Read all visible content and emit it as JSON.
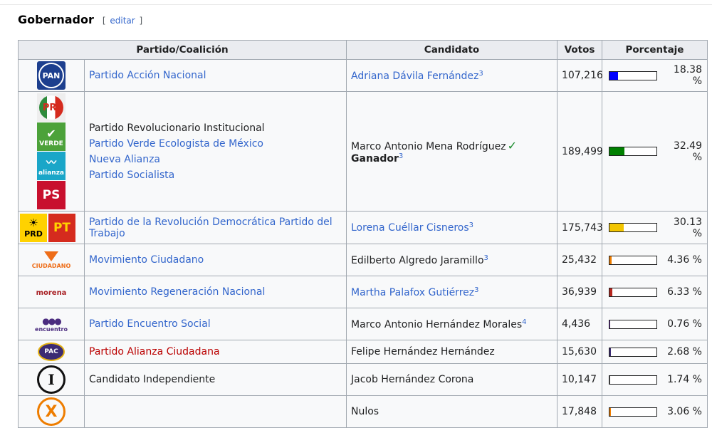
{
  "section": {
    "title": "Gobernador",
    "edit_open": "[",
    "edit_label": "editar",
    "edit_close": "]"
  },
  "table": {
    "headers": [
      "Partido/Coalición",
      "Candidato",
      "Votos",
      "Porcentaje"
    ],
    "rows": [
      {
        "logo_icons": [
          "pan-logo"
        ],
        "logo_texts": [
          "PAN"
        ],
        "parties": [
          "Partido Acción Nacional"
        ],
        "party_link": "blue",
        "candidate": "Adriana Dávila Fernández",
        "note": "3",
        "candidate_link": true,
        "votes": "107,216",
        "percent": "18.38 %",
        "share": 0.1838,
        "bar_color": "#0000ff"
      },
      {
        "logo_icons": [
          "pri-logo",
          "verde-logo",
          "nueva-alianza-logo",
          "ps-logo"
        ],
        "logo_texts": [
          "PRI",
          "VERDE",
          "alianza",
          "PS"
        ],
        "parties": [
          "Partido Revolucionario Institucional",
          "Partido Verde Ecologista de México",
          "Nueva Alianza",
          "Partido Socialista"
        ],
        "party_link": "mixed",
        "candidate": "Marco Antonio Mena Rodríguez",
        "winner_label": "Ganador",
        "note": "3",
        "candidate_link": false,
        "votes": "189,499",
        "percent": "32.49 %",
        "share": 0.3249,
        "bar_color": "#008000"
      },
      {
        "logo_icons": [
          "prd-logo",
          "pt-logo"
        ],
        "logo_texts": [
          "PRD",
          "PT"
        ],
        "parties": [
          "Partido de la Revolución Democrática Partido del Trabajo"
        ],
        "party_link": "blue",
        "candidate": "Lorena Cuéllar Cisneros",
        "note": "3",
        "candidate_link": true,
        "votes": "175,743",
        "percent": "30.13 %",
        "share": 0.3013,
        "bar_color": "#f2c500"
      },
      {
        "logo_icons": [
          "movimiento-ciudadano-logo"
        ],
        "logo_texts": [
          "CIUDADANO"
        ],
        "parties": [
          "Movimiento Ciudadano"
        ],
        "party_link": "blue",
        "candidate": "Edilberto Algredo Jaramillo",
        "note": "3",
        "candidate_link": false,
        "votes": "25,432",
        "percent": "4.36 %",
        "share": 0.0436,
        "bar_color": "#ee7d00"
      },
      {
        "logo_icons": [
          "morena-logo"
        ],
        "logo_texts": [
          "morena"
        ],
        "parties": [
          "Movimiento Regeneración Nacional"
        ],
        "party_link": "blue",
        "candidate": "Martha Palafox Gutiérrez",
        "note": "3",
        "candidate_link": true,
        "votes": "36,939",
        "percent": "6.33 %",
        "share": 0.0633,
        "bar_color": "#b5261e"
      },
      {
        "logo_icons": [
          "encuentro-social-logo"
        ],
        "logo_texts": [
          "encuentro"
        ],
        "parties": [
          "Partido Encuentro Social"
        ],
        "party_link": "blue",
        "candidate": "Marco Antonio Hernández Morales",
        "note": "4",
        "candidate_link": false,
        "votes": "4,436",
        "percent": "0.76 %",
        "share": 0.0076,
        "bar_color": "#5a2d82"
      },
      {
        "logo_icons": [
          "pac-logo"
        ],
        "logo_texts": [
          "PAC"
        ],
        "parties": [
          "Partido Alianza Ciudadana"
        ],
        "party_link": "red",
        "candidate": "Felipe Hernández Hernández",
        "note": "",
        "candidate_link": false,
        "votes": "15,630",
        "percent": "2.68 %",
        "share": 0.0268,
        "bar_color": "#3b2b73"
      },
      {
        "logo_icons": [
          "independiente-logo"
        ],
        "logo_texts": [
          "I"
        ],
        "parties": [
          "Candidato Independiente"
        ],
        "party_link": "none",
        "candidate": "Jacob Hernández Corona",
        "note": "",
        "candidate_link": false,
        "votes": "10,147",
        "percent": "1.74 %",
        "share": 0.0174,
        "bar_color": "#555555"
      },
      {
        "logo_icons": [
          "nulos-logo"
        ],
        "logo_texts": [
          "X"
        ],
        "parties": [
          ""
        ],
        "party_link": "none",
        "candidate": "Nulos",
        "note": "",
        "candidate_link": false,
        "votes": "17,848",
        "percent": "3.06 %",
        "share": 0.0306,
        "bar_color": "#ee7d00"
      }
    ]
  }
}
